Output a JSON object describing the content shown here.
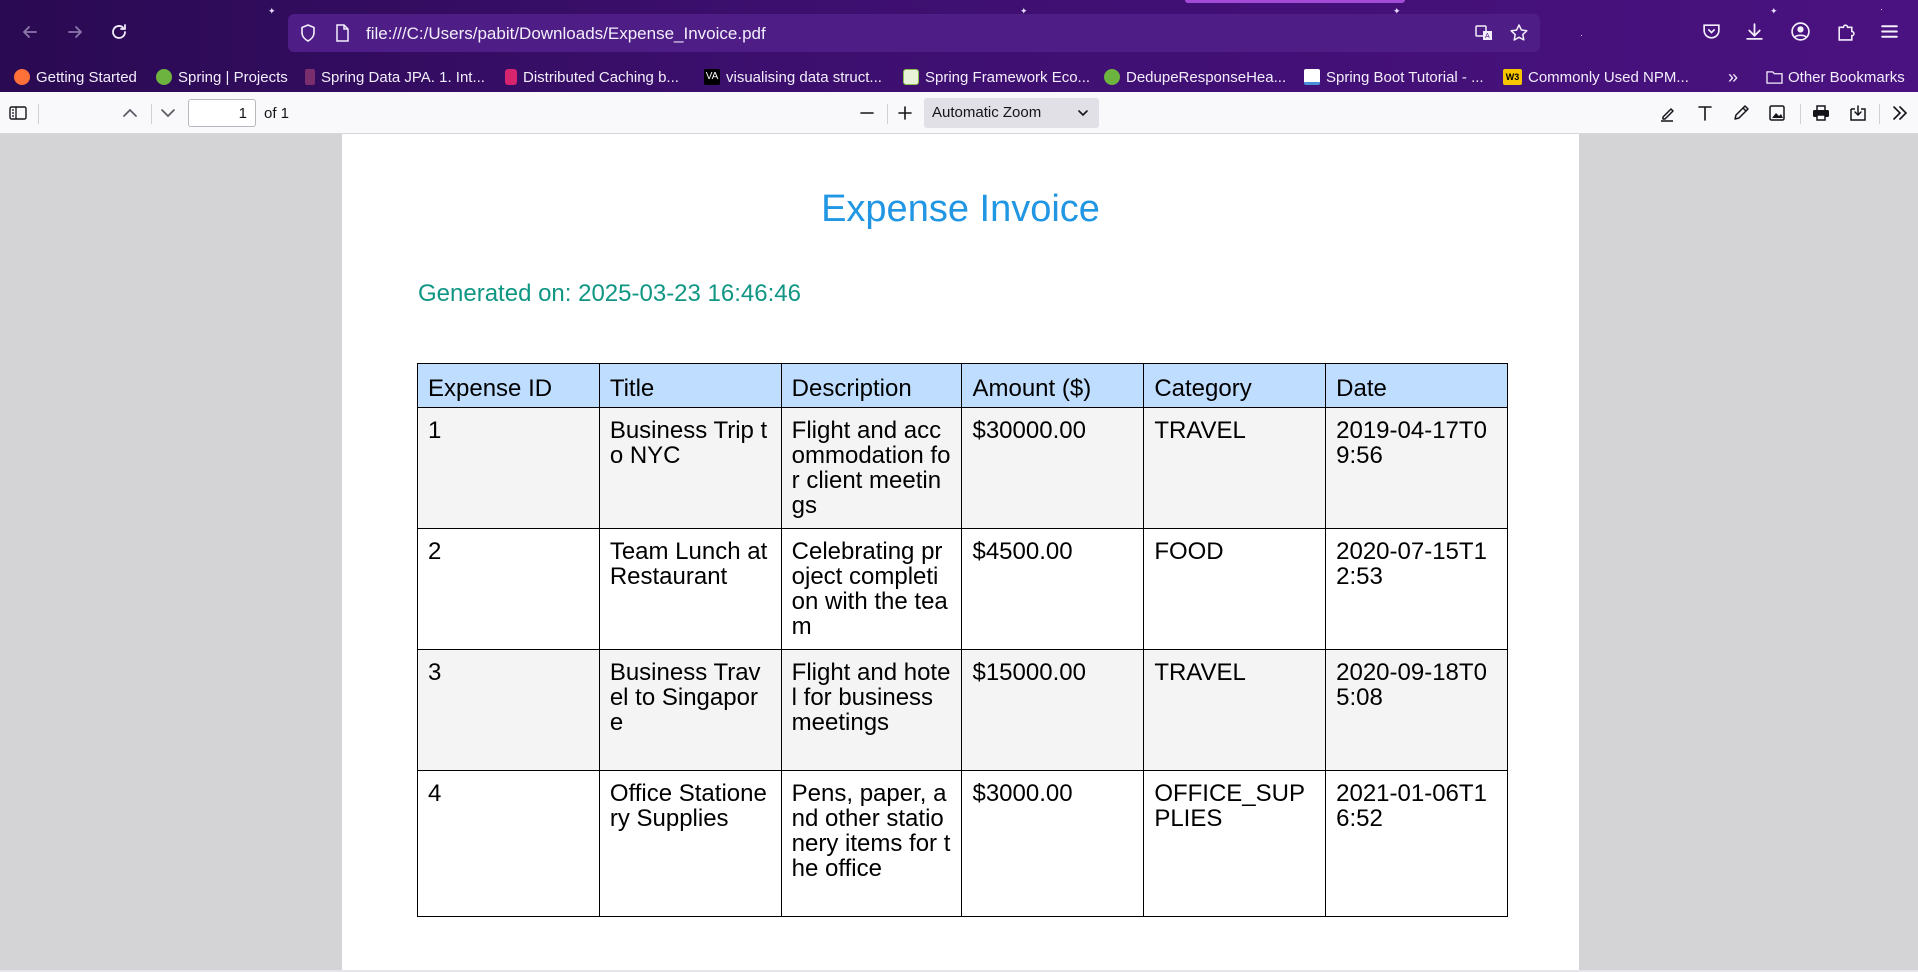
{
  "browser": {
    "url": "file:///C:/Users/pabit/Downloads/Expense_Invoice.pdf",
    "bookmarks": [
      {
        "label": "Getting Started",
        "color": "#ff7139"
      },
      {
        "label": "Spring | Projects",
        "color": "#6db33f"
      },
      {
        "label": "Spring Data JPA. 1. Int...",
        "color": "#7a2e6e"
      },
      {
        "label": "Distributed Caching b...",
        "color": "#d6246e"
      },
      {
        "label": "visualising data struct...",
        "color": "#000000"
      },
      {
        "label": "Spring Framework Eco...",
        "color": "#8bc34a"
      },
      {
        "label": "DedupeResponseHea...",
        "color": "#6db33f"
      },
      {
        "label": "Spring Boot Tutorial - ...",
        "color": "#4a90d9"
      },
      {
        "label": "Commonly Used NPM...",
        "color": "#f7c600"
      }
    ],
    "other_bookmarks": "Other Bookmarks"
  },
  "pdf_toolbar": {
    "page_number": "1",
    "page_of": "of 1",
    "zoom": "Automatic Zoom"
  },
  "document": {
    "title": "Expense Invoice",
    "generated": "Generated on: 2025-03-23 16:46:46",
    "columns": [
      "Expense ID",
      "Title",
      "Description",
      "Amount ($)",
      "Category",
      "Date"
    ],
    "rows": [
      [
        "1",
        "Business Trip to NYC",
        "Flight and accommodation for client meetings",
        "$30000.00",
        "TRAVEL",
        "2019-04-17T09:56"
      ],
      [
        "2",
        "Team Lunch at Restaurant",
        "Celebrating project completion with the team",
        "$4500.00",
        "FOOD",
        "2020-07-15T12:53"
      ],
      [
        "3",
        "Business Travel to Singapore",
        "Flight and hotel for business meetings",
        "$15000.00",
        "TRAVEL",
        "2020-09-18T05:08"
      ],
      [
        "4",
        "Office Stationery Supplies",
        "Pens, paper, and other stationery items for the office",
        "$3000.00",
        "OFFICE_SUPPLIES",
        "2021-01-06T16:52"
      ]
    ]
  },
  "colors": {
    "title": "#2196e3",
    "generated": "#109684",
    "header_bg": "#bfdeff",
    "chrome_bg": "#3c0f6e"
  }
}
